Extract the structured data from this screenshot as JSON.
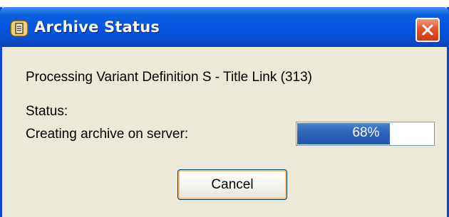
{
  "window": {
    "title": "Archive Status",
    "title_icon": "archive-icon",
    "close_icon": "close-icon",
    "accent_color": "#0554e0",
    "close_color": "#e4552b"
  },
  "main": {
    "processing_text": "Processing Variant Definition S - Title Link (313)",
    "status_label": "Status:",
    "status_detail": "Creating archive on server:",
    "progress": {
      "value": 0.68,
      "label": "68%"
    },
    "cancel_label": "Cancel"
  }
}
